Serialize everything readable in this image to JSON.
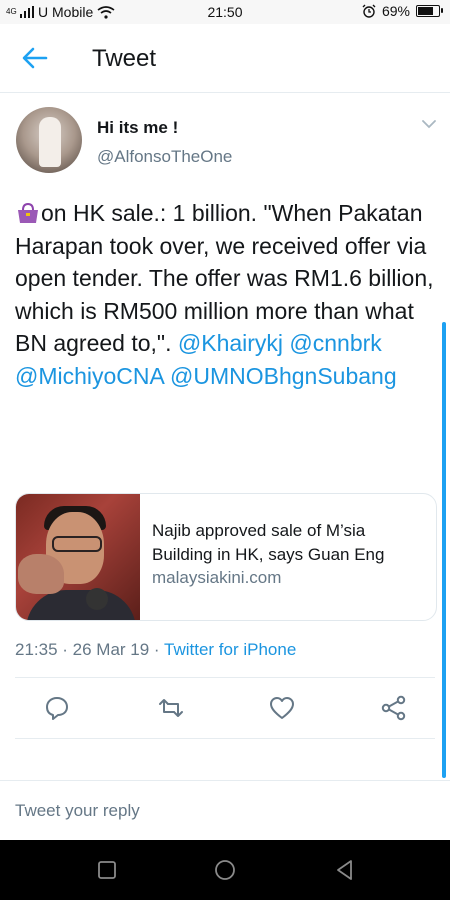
{
  "status_bar": {
    "network_tag": "4G",
    "carrier": "U Mobile",
    "time": "21:50",
    "battery": "69%",
    "battery_level": 0.69
  },
  "header": {
    "title": "Tweet"
  },
  "tweet": {
    "display_name": "Hi  its me !",
    "handle": "@AlfonsoTheOne",
    "text_line1": "on HK sale.: 1 billion.",
    "text_body": "\"When Pakatan Harapan took over, we received offer via open tender. The offer was RM1.6 billion, which is RM500 million more than what BN agreed to,\".",
    "mentions": [
      "@Khairykj",
      "@cnnbrk",
      "@MichiyoCNA",
      "@UMNOBhgnSubang"
    ],
    "card": {
      "title": "Najib approved sale of M’sia Building in HK, says Guan Eng",
      "domain": "malaysiakini.com"
    },
    "timestamp": "21:35 · 26 Mar 19 · ",
    "source": "Twitter for iPhone"
  },
  "reply": {
    "placeholder": "Tweet your reply"
  },
  "colors": {
    "accent": "#1da1f2",
    "link": "#1b95e0",
    "secondary_text": "#657786",
    "icon": "#657786"
  }
}
